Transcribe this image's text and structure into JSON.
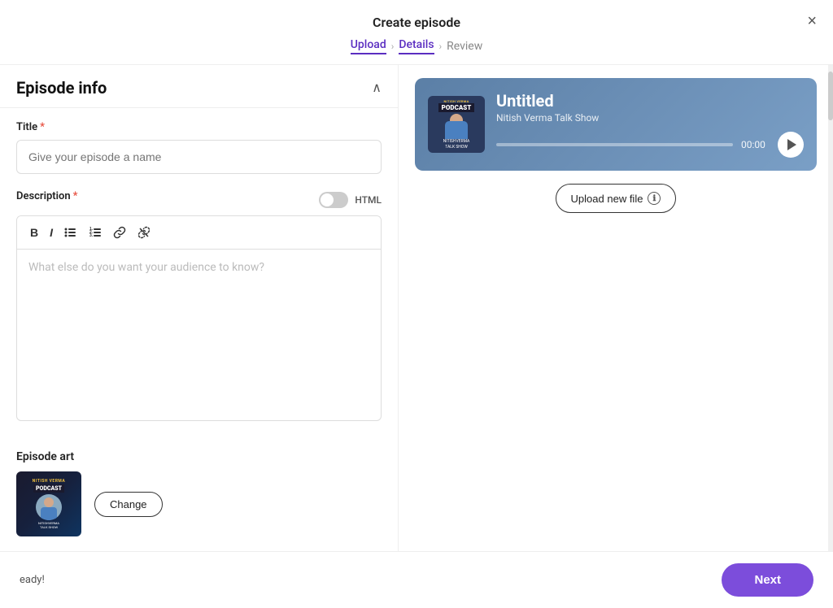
{
  "modal": {
    "title": "Create episode",
    "close_label": "×"
  },
  "breadcrumb": {
    "steps": [
      {
        "label": "Upload",
        "state": "done"
      },
      {
        "label": "Details",
        "state": "active"
      },
      {
        "label": "Review",
        "state": "inactive"
      }
    ]
  },
  "episode_info": {
    "section_title": "Episode info",
    "title_label": "Title",
    "title_required": true,
    "title_placeholder": "Give your episode a name",
    "description_label": "Description",
    "description_required": true,
    "description_placeholder": "What else do you want your audience to know?",
    "html_toggle_label": "HTML",
    "toolbar": {
      "bold": "B",
      "italic": "I",
      "bullet_list": "☰",
      "ordered_list": "≡",
      "link": "🔗",
      "unlink": "⛓"
    }
  },
  "episode_art": {
    "label": "Episode art",
    "change_button_label": "Change"
  },
  "audio_player": {
    "title": "Untitled",
    "subtitle": "Nitish Verma Talk Show",
    "time": "00:00"
  },
  "upload": {
    "button_label": "Upload new file",
    "info_icon_label": "ℹ"
  },
  "footer": {
    "status": "eady!",
    "next_label": "Next"
  }
}
